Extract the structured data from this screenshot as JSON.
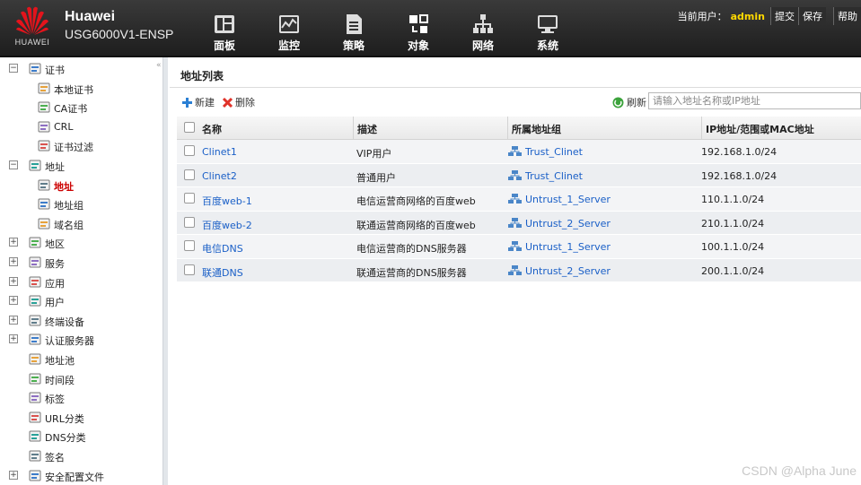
{
  "header": {
    "logo_text": "HUAWEI",
    "brand_name": "Huawei",
    "model": "USG6000V1-ENSP",
    "nav": [
      {
        "label": "面板",
        "icon": "dashboard-icon"
      },
      {
        "label": "监控",
        "icon": "monitor-icon"
      },
      {
        "label": "策略",
        "icon": "policy-icon"
      },
      {
        "label": "对象",
        "icon": "object-icon"
      },
      {
        "label": "网络",
        "icon": "network-icon"
      },
      {
        "label": "系统",
        "icon": "system-icon"
      }
    ],
    "user_label": "当前用户：",
    "user_name": "admin",
    "submit": "提交",
    "save": "保存",
    "help": "帮助",
    "accent": "#ffd800"
  },
  "sidebar": {
    "items": [
      {
        "label": "证书",
        "toggle": "−",
        "level": 0,
        "icon": "certificate-icon"
      },
      {
        "label": "本地证书",
        "level": 1,
        "icon": "local-certificate-icon"
      },
      {
        "label": "CA证书",
        "level": 1,
        "icon": "ca-certificate-icon"
      },
      {
        "label": "CRL",
        "level": 1,
        "icon": "crl-icon"
      },
      {
        "label": "证书过滤",
        "level": 1,
        "icon": "certificate-filter-icon"
      },
      {
        "label": "地址",
        "toggle": "−",
        "level": 0,
        "icon": "address-icon"
      },
      {
        "label": "地址",
        "level": 1,
        "icon": "address-monitor-icon",
        "active": true
      },
      {
        "label": "地址组",
        "level": 1,
        "icon": "address-group-icon"
      },
      {
        "label": "域名组",
        "level": 1,
        "icon": "domain-group-icon"
      },
      {
        "label": "地区",
        "toggle": "+",
        "level": 0,
        "icon": "region-icon"
      },
      {
        "label": "服务",
        "toggle": "+",
        "level": 0,
        "icon": "service-icon"
      },
      {
        "label": "应用",
        "toggle": "+",
        "level": 0,
        "icon": "application-icon"
      },
      {
        "label": "用户",
        "toggle": "+",
        "level": 0,
        "icon": "user-icon"
      },
      {
        "label": "终端设备",
        "toggle": "+",
        "level": 0,
        "icon": "terminal-device-icon"
      },
      {
        "label": "认证服务器",
        "toggle": "+",
        "level": 0,
        "icon": "auth-server-icon"
      },
      {
        "label": "地址池",
        "level": 0,
        "icon": "address-pool-icon"
      },
      {
        "label": "时间段",
        "level": 0,
        "icon": "time-range-icon"
      },
      {
        "label": "标签",
        "level": 0,
        "icon": "tag-icon"
      },
      {
        "label": "URL分类",
        "level": 0,
        "icon": "url-category-icon"
      },
      {
        "label": "DNS分类",
        "level": 0,
        "icon": "dns-category-icon"
      },
      {
        "label": "签名",
        "level": 0,
        "icon": "signature-icon"
      },
      {
        "label": "安全配置文件",
        "toggle": "+",
        "level": 0,
        "icon": "security-profile-icon"
      }
    ]
  },
  "main": {
    "title": "地址列表",
    "toolbar": {
      "new_label": "新建",
      "delete_label": "删除",
      "refresh_label": "刷新",
      "search_placeholder": "请输入地址名称或IP地址"
    },
    "columns": [
      "名称",
      "描述",
      "所属地址组",
      "IP地址/范围或MAC地址"
    ],
    "rows": [
      {
        "name": "Clinet1",
        "desc": "VIP用户",
        "group": "Trust_Clinet",
        "ip": "192.168.1.0/24"
      },
      {
        "name": "Clinet2",
        "desc": "普通用户",
        "group": "Trust_Clinet",
        "ip": "192.168.1.0/24"
      },
      {
        "name": "百度web-1",
        "desc": "电信运营商网络的百度web",
        "group": "Untrust_1_Server",
        "ip": "110.1.1.0/24"
      },
      {
        "name": "百度web-2",
        "desc": "联通运营商网络的百度web",
        "group": "Untrust_2_Server",
        "ip": "210.1.1.0/24"
      },
      {
        "name": "电信DNS",
        "desc": "电信运营商的DNS服务器",
        "group": "Untrust_1_Server",
        "ip": "100.1.1.0/24"
      },
      {
        "name": "联通DNS",
        "desc": "联通运营商的DNS服务器",
        "group": "Untrust_2_Server",
        "ip": "200.1.1.0/24"
      }
    ],
    "link_color": "#1a5fc7"
  },
  "watermark": "CSDN @Alpha June"
}
